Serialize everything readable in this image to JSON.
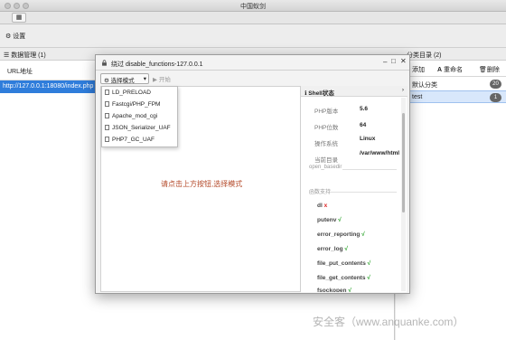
{
  "app": {
    "title": "中国蚁剑"
  },
  "toolbar": {
    "settings_label": "设置"
  },
  "left": {
    "header": "数据管理 (1)",
    "column": "URL地址",
    "row_url": "http://127.0.0.1:18080/index.php"
  },
  "right": {
    "header": "分类目录 (2)",
    "add": "添加",
    "rename": "重命名",
    "delete": "删除",
    "categories": [
      {
        "name": "默认分类",
        "count": "20"
      },
      {
        "name": "test",
        "count": "1"
      }
    ]
  },
  "modal": {
    "title": "绕过 disable_functions-127.0.0.1",
    "mode_select": "选择模式",
    "start": "开始",
    "modes": [
      "LD_PRELOAD",
      "Fastcgi/PHP_FPM",
      "Apache_mod_cgi",
      "JSON_Serializer_UAF",
      "PHP7_GC_UAF"
    ],
    "hint": "请点击上方按钮,选择模式",
    "shell_header": "Shell状态",
    "info": [
      {
        "k": "PHP版本",
        "v": "5.6"
      },
      {
        "k": "PHP位数",
        "v": "64"
      },
      {
        "k": "操作系统",
        "v": "Linux"
      },
      {
        "k": "当前目录",
        "v": "/var/www/html"
      }
    ],
    "open_basedir_label": "open_basedir",
    "func_label": "函数支持",
    "functions": [
      {
        "name": "dl",
        "mark": "x"
      },
      {
        "name": "putenv",
        "mark": "√"
      },
      {
        "name": "error_reporting",
        "mark": "√"
      },
      {
        "name": "error_log",
        "mark": "√"
      },
      {
        "name": "file_put_contents",
        "mark": "√"
      },
      {
        "name": "file_get_contents",
        "mark": "√"
      },
      {
        "name": "fsockopen",
        "mark": "√"
      }
    ]
  },
  "watermark": "安全客（www.anquanke.com）"
}
